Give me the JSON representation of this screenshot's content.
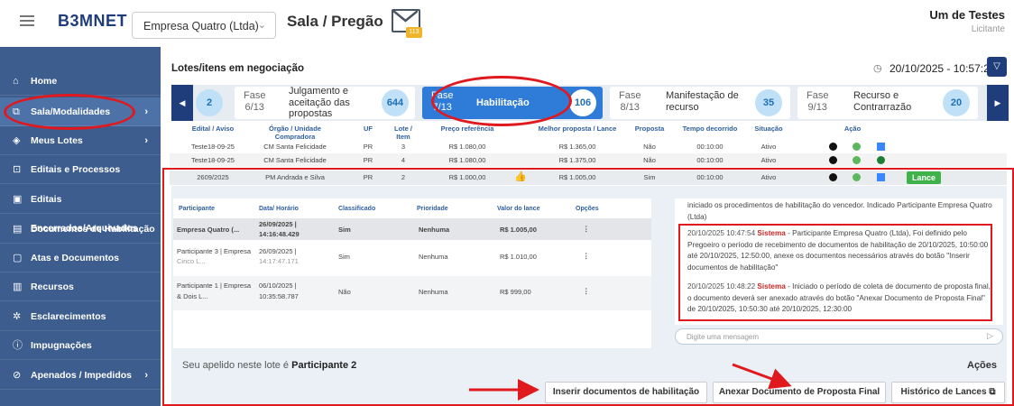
{
  "header": {
    "logo": "B3MNET",
    "company": "Empresa Quatro (Ltda)",
    "title": "Sala / Pregão",
    "mail_count": "113",
    "user_name": "Um de Testes",
    "user_role": "Licitante"
  },
  "sidebar": {
    "items": [
      {
        "label": "Home",
        "icon": "home-icon"
      },
      {
        "label": "Sala/Modalidades",
        "icon": "room-icon"
      },
      {
        "label": "Meus Lotes",
        "icon": "lots-icon"
      },
      {
        "label": "Editais e Processos",
        "icon": "cart-icon"
      },
      {
        "label": "Editais Encerrados/Arquivados",
        "icon": "archive-icon"
      },
      {
        "label": "Documentos de Habilitação",
        "icon": "doc-icon"
      },
      {
        "label": "Atas e Documentos",
        "icon": "file-icon"
      },
      {
        "label": "Recursos",
        "icon": "list-icon"
      },
      {
        "label": "Esclarecimentos",
        "icon": "sun-icon"
      },
      {
        "label": "Impugnações",
        "icon": "alert-icon"
      },
      {
        "label": "Apenados / Impedidos",
        "icon": "block-icon"
      }
    ]
  },
  "main": {
    "section_title": "Lotes/itens em negociação",
    "datetime": "20/10/2025 - 10:57:23",
    "prev_count": "2",
    "phases": [
      {
        "fase": "Fase",
        "num": "6/13",
        "name": "Julgamento e aceitação das propostas",
        "count": "644"
      },
      {
        "fase": "Fase",
        "num": "7/13",
        "name": "Habilitação",
        "count": "106"
      },
      {
        "fase": "Fase",
        "num": "8/13",
        "name": "Manifestação de recurso",
        "count": "35"
      },
      {
        "fase": "Fase",
        "num": "9/13",
        "name": "Recurso e Contrarrazão",
        "count": "20"
      }
    ],
    "columns": [
      "Edital / Aviso",
      "Órgão / Unidade Compradora",
      "UF",
      "Lote / Item",
      "Preço referência",
      "Melhor proposta / Lance",
      "Proposta",
      "Tempo decorrido",
      "Situação",
      "Ação"
    ],
    "rows": [
      {
        "edital": "Teste18-09-25",
        "orgao": "CM Santa Felicidade",
        "uf": "PR",
        "lote": "3",
        "preco": "R$ 1.080,00",
        "melhor": "R$ 1.365,00",
        "proposta": "Não",
        "tempo": "00:10:00",
        "situacao": "Ativo"
      },
      {
        "edital": "Teste18-09-25",
        "orgao": "CM Santa Felicidade",
        "uf": "PR",
        "lote": "4",
        "preco": "R$ 1.080,00",
        "melhor": "R$ 1.375,00",
        "proposta": "Não",
        "tempo": "00:10:00",
        "situacao": "Ativo"
      },
      {
        "edital": "2609/2025",
        "orgao": "PM Andrada e Silva",
        "uf": "PR",
        "lote": "2",
        "preco": "R$ 1.000,00",
        "melhor": "R$ 1.005,00",
        "proposta": "Sim",
        "tempo": "00:10:00",
        "situacao": "Ativo"
      }
    ],
    "lance_label": "Lance"
  },
  "detail": {
    "columns": [
      "Participante",
      "Data/ Horário",
      "Classificado",
      "Prioridade",
      "Valor do lance",
      "Opções"
    ],
    "rows": [
      {
        "participante": "Empresa Quatro (...",
        "data1": "26/09/2025 |",
        "data2": "14:16:48.429",
        "classificado": "Sim",
        "prioridade": "Nenhuma",
        "valor": "R$ 1.005,00"
      },
      {
        "participante": "Participante 3 | Empresa",
        "participante2": "Cinco L...",
        "data1": "26/09/2025 |",
        "data2": "14:17:47.171",
        "classificado": "Sim",
        "prioridade": "Nenhuma",
        "valor": "R$ 1.010,00"
      },
      {
        "participante": "Participante 1 | Empresa",
        "participante2": "& Dois L...",
        "data1": "06/10/2025 |",
        "data2": "10:35:58.787",
        "classificado": "Não",
        "prioridade": "Nenhuma",
        "valor": "R$ 999,00"
      }
    ],
    "options_glyph": "⋮",
    "chat": {
      "first": "iniciado os procedimentos de habilitação do vencedor. Indicado Participante Empresa Quatro (Ltda)",
      "messages": [
        {
          "ts": "20/10/2025 10:47:54",
          "sender": "Sistema",
          "text": "- Participante Empresa Quatro (Ltda), Foi definido pelo Pregoeiro o período de recebimento de documentos de habilitação de 20/10/2025, 10:50:00 até 20/10/2025, 12:50:00, anexe os documentos necessários através do botão \"Inserir documentos de habilitação\""
        },
        {
          "ts": "20/10/2025 10:48:22",
          "sender": "Sistema",
          "text": "- Iniciado o período de coleta de documento de proposta final, o documento deverá ser anexado através do botão \"Anexar Documento de Proposta Final\" de 20/10/2025, 10:50:30 até 20/10/2025, 12:30:00"
        }
      ],
      "placeholder": "Digite uma mensagem"
    },
    "apelido_prefix": "Seu apelido neste lote é",
    "apelido_name": "Participante 2",
    "acoes": "Ações",
    "buttons": [
      "Inserir documentos de habilitação",
      "Anexar Documento de Proposta Final",
      "Histórico de Lances"
    ]
  },
  "colors": {
    "sidebar": "#3c5d8e",
    "primary": "#1f3d7a",
    "accent": "#2f7bd8",
    "annotation": "#e0191f",
    "lance": "#3fb24a"
  }
}
